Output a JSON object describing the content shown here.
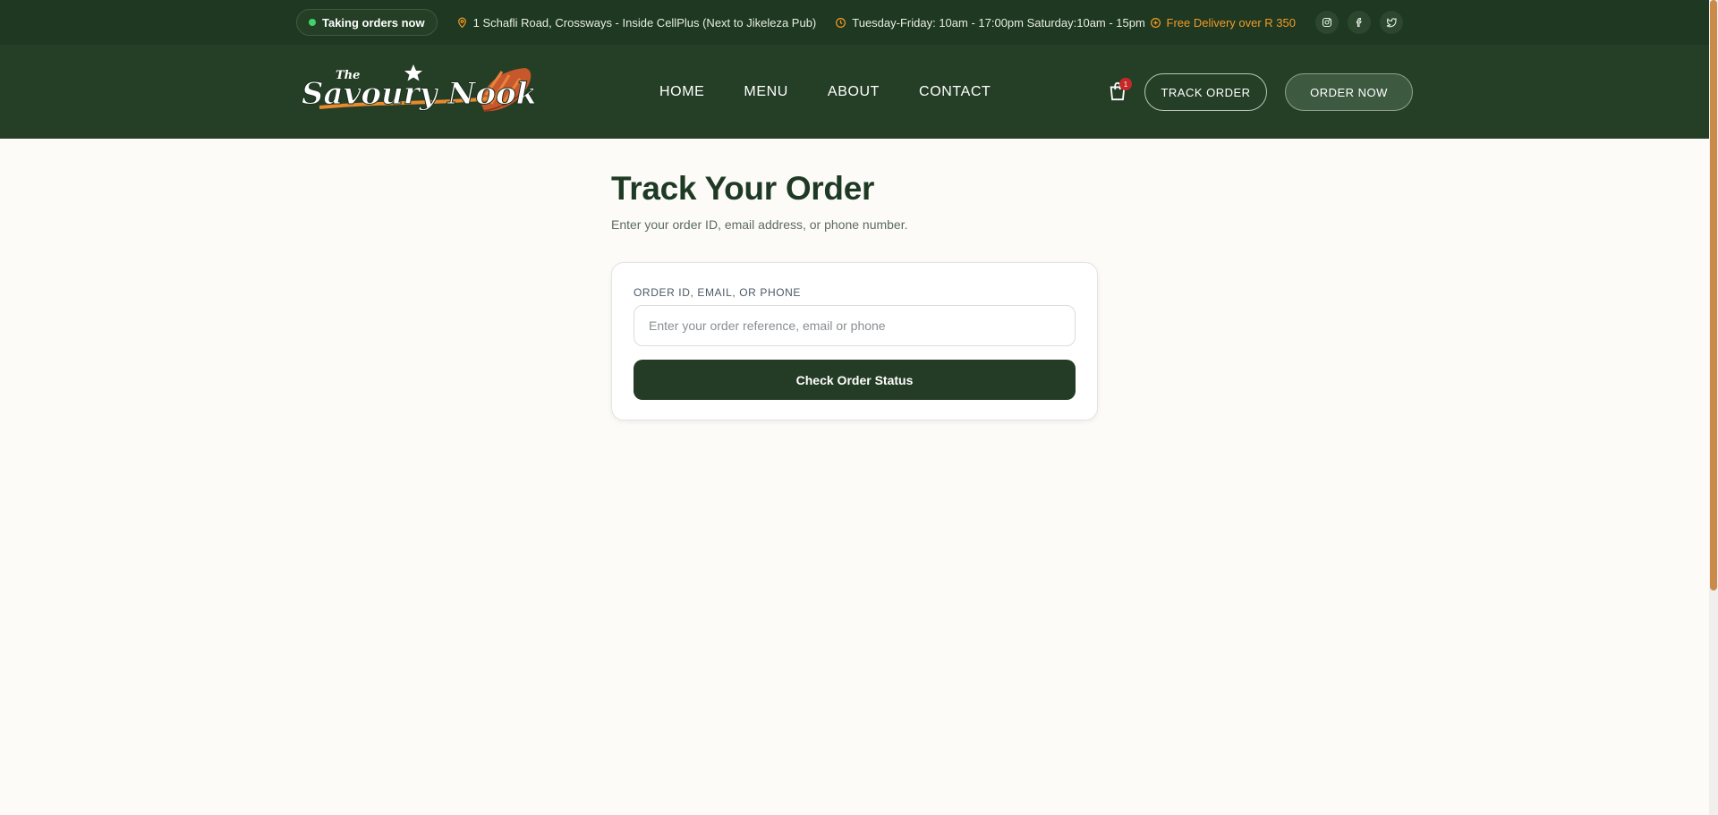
{
  "topbar": {
    "status": "Taking orders now",
    "address": "1 Schafli Road, Crossways - Inside CellPlus (Next to Jikeleza Pub)",
    "hours": "Tuesday-Friday: 10am - 17:00pm Saturday:10am - 15pm",
    "delivery": "Free Delivery over R 350",
    "icons": [
      "location-pin-icon",
      "clock-icon",
      "plus-circle-icon",
      "instagram-icon",
      "facebook-icon",
      "twitter-icon"
    ]
  },
  "header": {
    "brand_small": "The",
    "brand_main": "Savoury Nook",
    "nav": [
      "HOME",
      "MENU",
      "ABOUT",
      "CONTACT"
    ],
    "cart_count": "1",
    "track_label": "TRACK ORDER",
    "order_label": "ORDER NOW"
  },
  "main": {
    "title": "Track Your Order",
    "subtitle": "Enter your order ID, email address, or phone number.",
    "field_label": "ORDER ID, EMAIL, OR PHONE",
    "placeholder": "Enter your order reference, email or phone",
    "submit_label": "Check Order Status"
  },
  "colors": {
    "topbar_bg": "#1f3821",
    "header_bg": "#253f27",
    "accent_orange": "#f29a25",
    "status_green": "#3fd36a",
    "page_bg": "#fcfbf8",
    "primary_button": "#243c25"
  }
}
